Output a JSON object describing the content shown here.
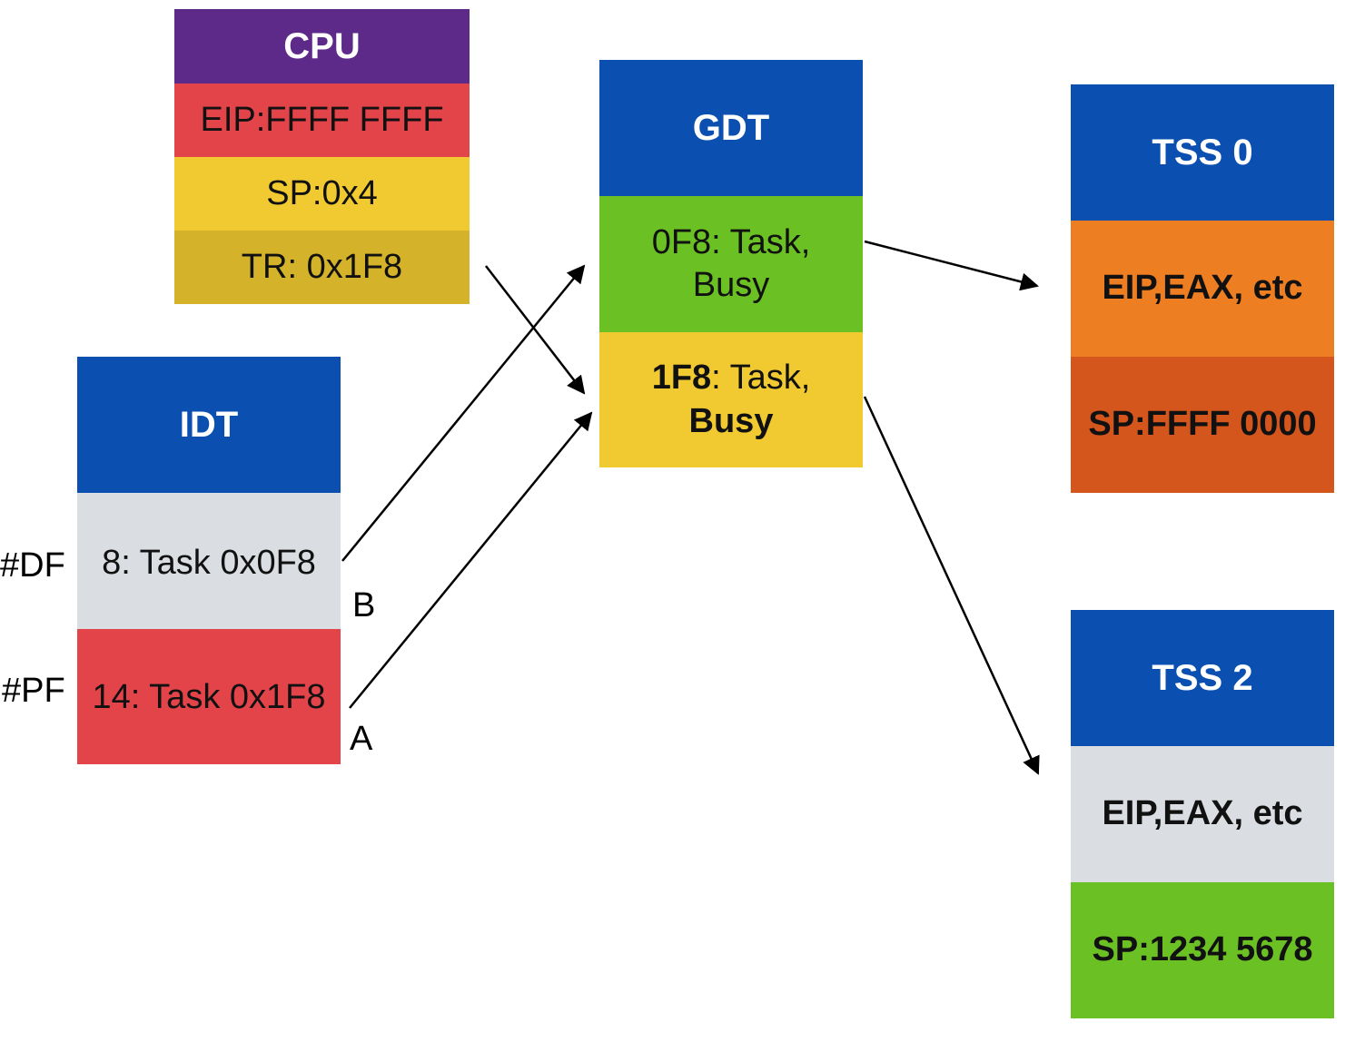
{
  "cpu": {
    "title": "CPU",
    "eip": "EIP:FFFF FFFF",
    "sp": "SP:0x4",
    "tr": "TR: 0x1F8"
  },
  "gdt": {
    "title": "GDT",
    "entry0": "0F8: Task,",
    "entry0_b": "Busy",
    "entry1_sel": "1F8",
    "entry1_rest": ": Task,",
    "entry1_b": "Busy"
  },
  "tss0": {
    "title": "TSS 0",
    "regs": "EIP,EAX, etc",
    "sp": "SP:FFFF 0000"
  },
  "tss2": {
    "title": "TSS 2",
    "regs": "EIP,EAX, etc",
    "sp": "SP:1234 5678"
  },
  "idt": {
    "title": "IDT",
    "entry8": "8: Task 0x0F8",
    "entry14": "14: Task 0x1F8"
  },
  "labels": {
    "df": "#DF",
    "pf": "#PF",
    "b": "B",
    "a": "A"
  },
  "colors": {
    "blue": "#0B4FB0",
    "purple": "#5E2A8A",
    "red": "#E3444A",
    "yellow": "#F1C930",
    "olive": "#D4B22A",
    "green": "#6BC124",
    "orange": "#EE7E22",
    "dark_orange": "#D4561C",
    "gray": "#DADDE1"
  }
}
